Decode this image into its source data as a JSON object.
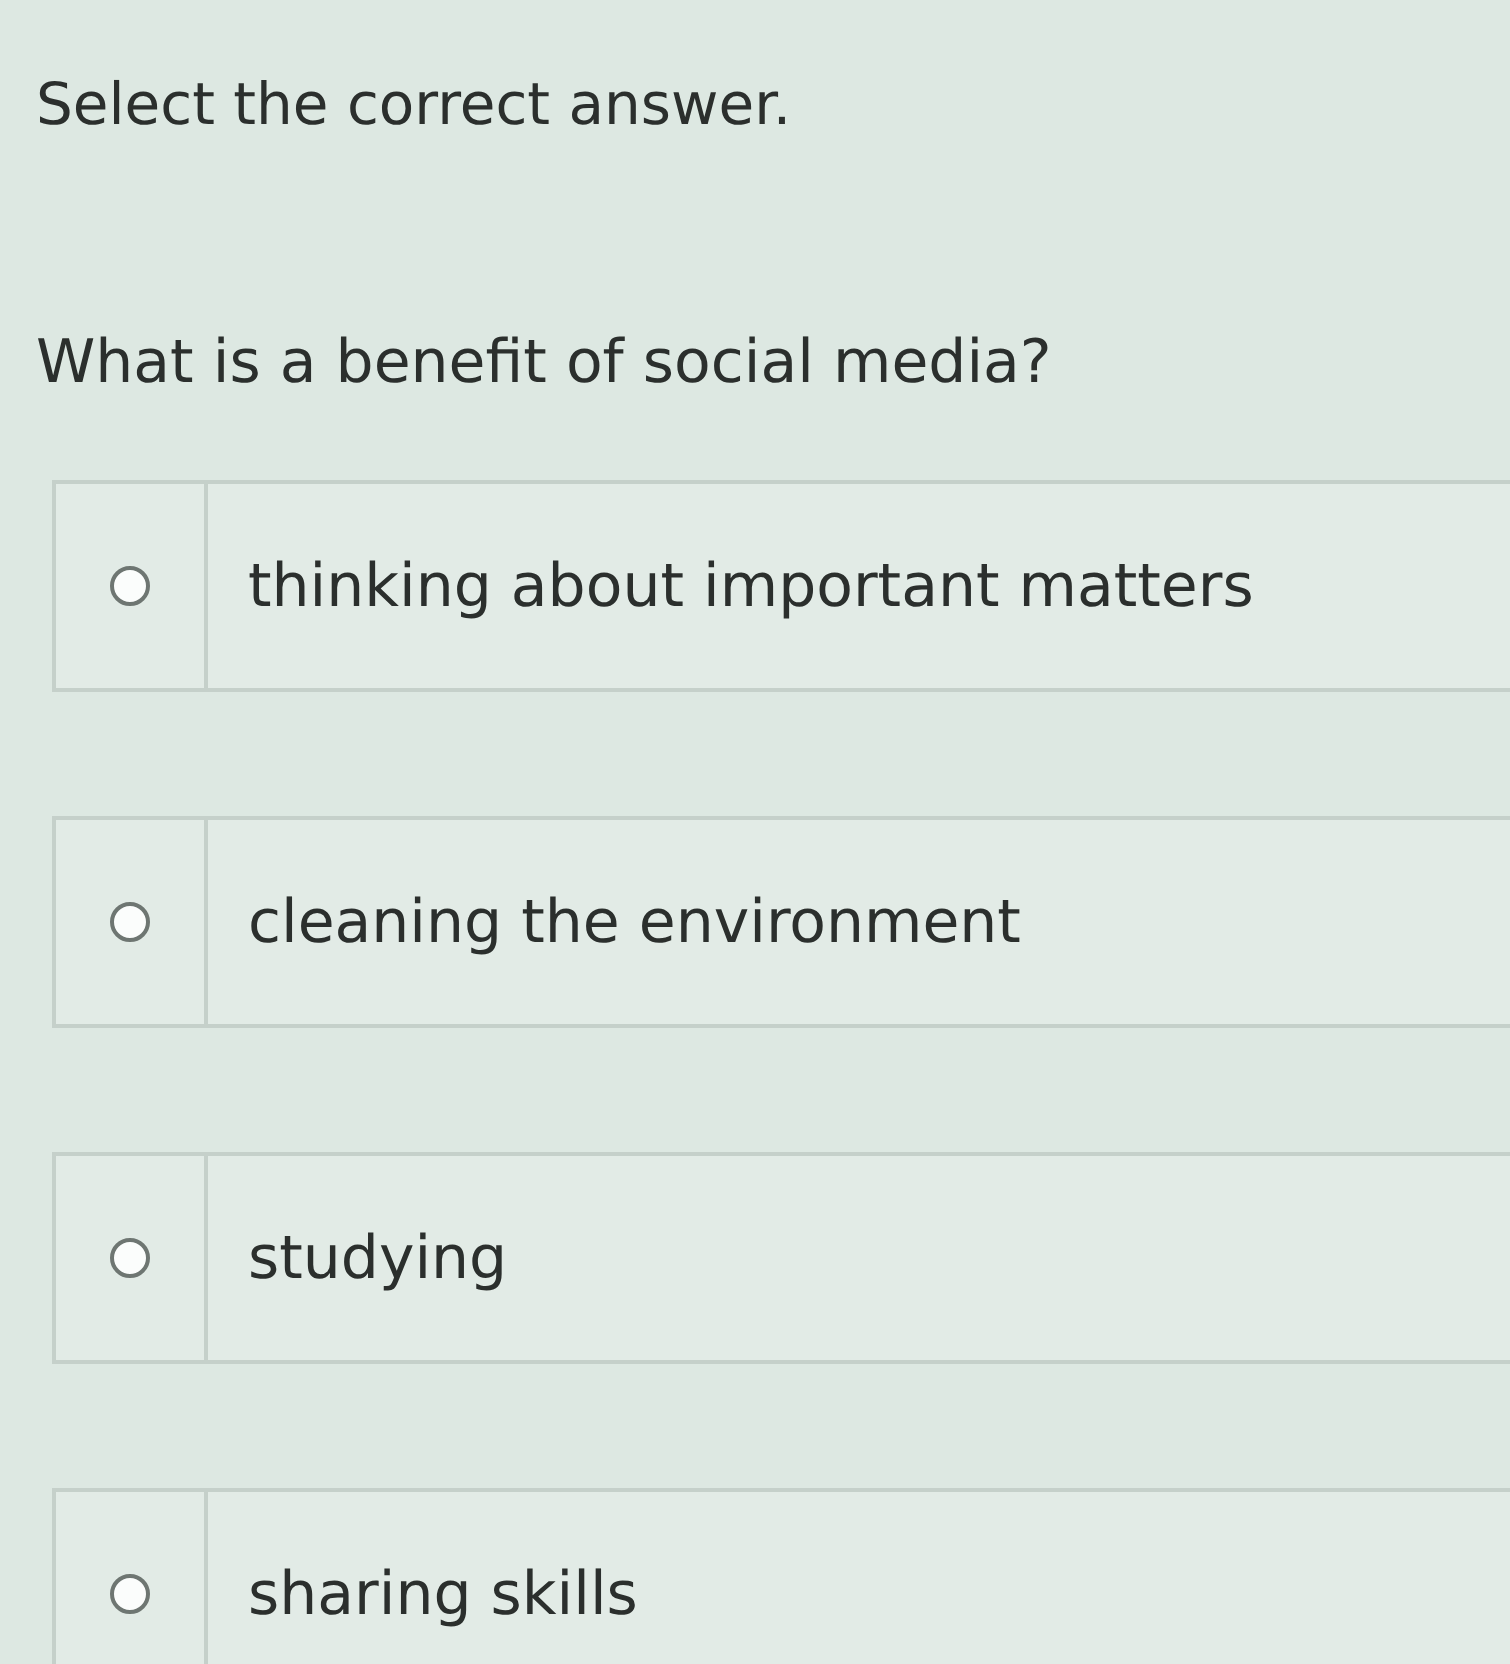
{
  "instruction": "Select the correct answer.",
  "question": "What is a benefit of social media?",
  "options": [
    {
      "label": "thinking about important matters",
      "selected": false
    },
    {
      "label": "cleaning the environment",
      "selected": false
    },
    {
      "label": "studying",
      "selected": false
    },
    {
      "label": "sharing skills",
      "selected": false
    }
  ]
}
